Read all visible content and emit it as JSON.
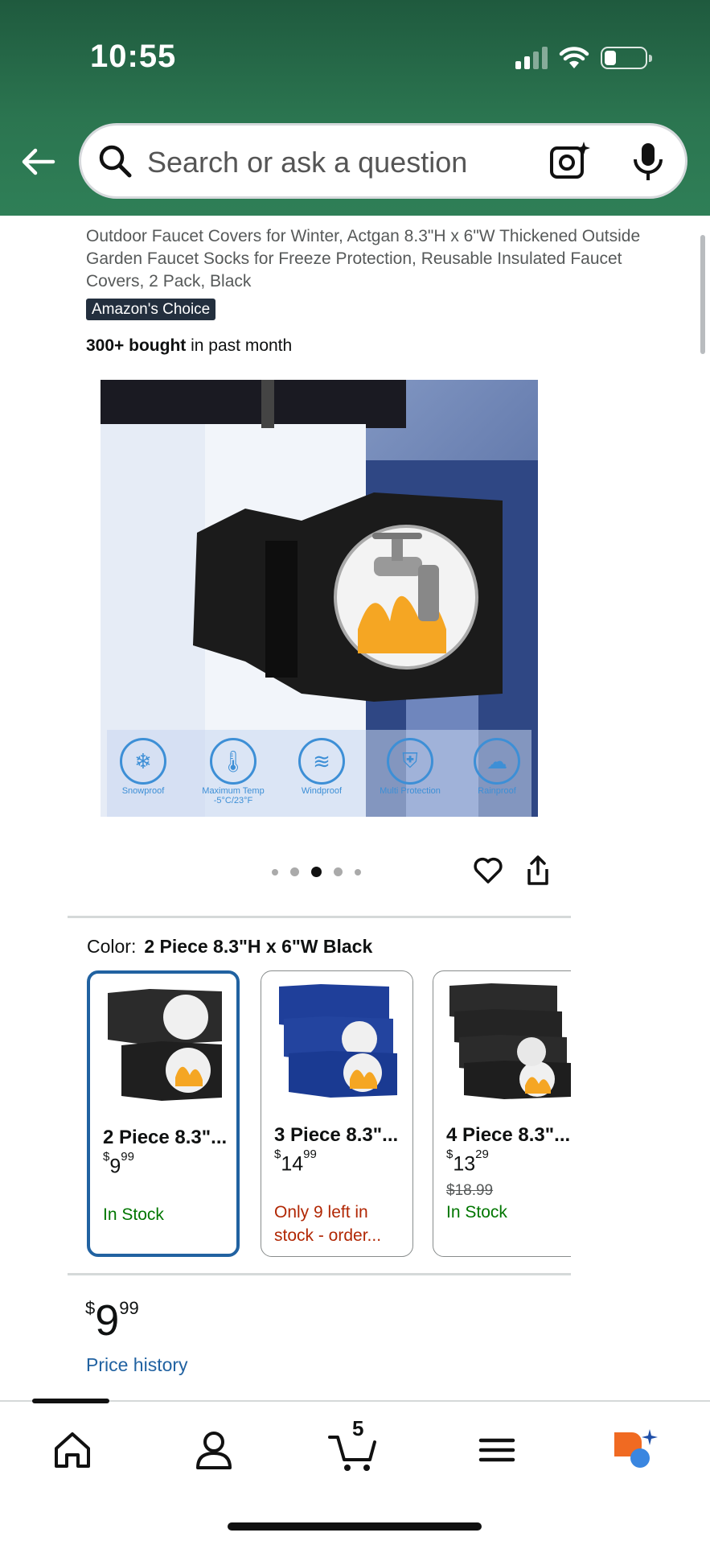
{
  "status_bar": {
    "time": "10:55"
  },
  "search": {
    "placeholder": "Search or ask a question"
  },
  "product": {
    "title": "Outdoor Faucet Covers for Winter, Actgan 8.3\"H x 6\"W Thickened Outside Garden Faucet Socks for Freeze Protection, Reusable Insulated Faucet Covers, 2 Pack, Black",
    "badge": "Amazon's Choice",
    "bought_bold": "300+ bought",
    "bought_rest": " in past month",
    "image_features": [
      {
        "label": "Snowproof",
        "icon": "snowflake-icon"
      },
      {
        "label": "Maximum Temp -5°C/23°F",
        "icon": "thermometer-icon"
      },
      {
        "label": "Windproof",
        "icon": "wind-icon"
      },
      {
        "label": "Multi Protection",
        "icon": "shield-icon"
      },
      {
        "label": "Rainproof",
        "icon": "cloud-icon"
      }
    ],
    "image_pager": {
      "count": 5,
      "active": 3
    }
  },
  "color": {
    "label": "Color:",
    "value": "2 Piece 8.3\"H x 6\"W Black",
    "options": [
      {
        "name": "2 Piece 8.3\"...",
        "price_whole": "9",
        "price_frac": "99",
        "old_price": "",
        "stock": "In Stock",
        "stock_type": "in",
        "color": "#2b2b2b",
        "selected": true
      },
      {
        "name": "3 Piece 8.3\"...",
        "price_whole": "14",
        "price_frac": "99",
        "old_price": "",
        "stock": "Only 9 left in stock - order...",
        "stock_line1": "Only 9 left in",
        "stock_line2": "stock - order...",
        "stock_type": "low",
        "color": "#1f3f9a",
        "selected": false
      },
      {
        "name": "4 Piece 8.3\"...",
        "price_whole": "13",
        "price_frac": "29",
        "old_price": "$18.99",
        "stock": "In Stock",
        "stock_type": "in",
        "color": "#2b2b2b",
        "selected": false
      }
    ]
  },
  "price": {
    "symbol": "$",
    "whole": "9",
    "fraction": "99",
    "history_link": "Price history"
  },
  "bottom_nav": {
    "cart_count": "5",
    "items": [
      "home-icon",
      "account-icon",
      "cart-icon",
      "menu-icon",
      "rufus-icon"
    ]
  },
  "colors": {
    "header_green": "#2b7550",
    "link_blue": "#2162a1",
    "in_stock": "#007600",
    "low_stock": "#b12704",
    "badge_bg": "#232f3e"
  }
}
